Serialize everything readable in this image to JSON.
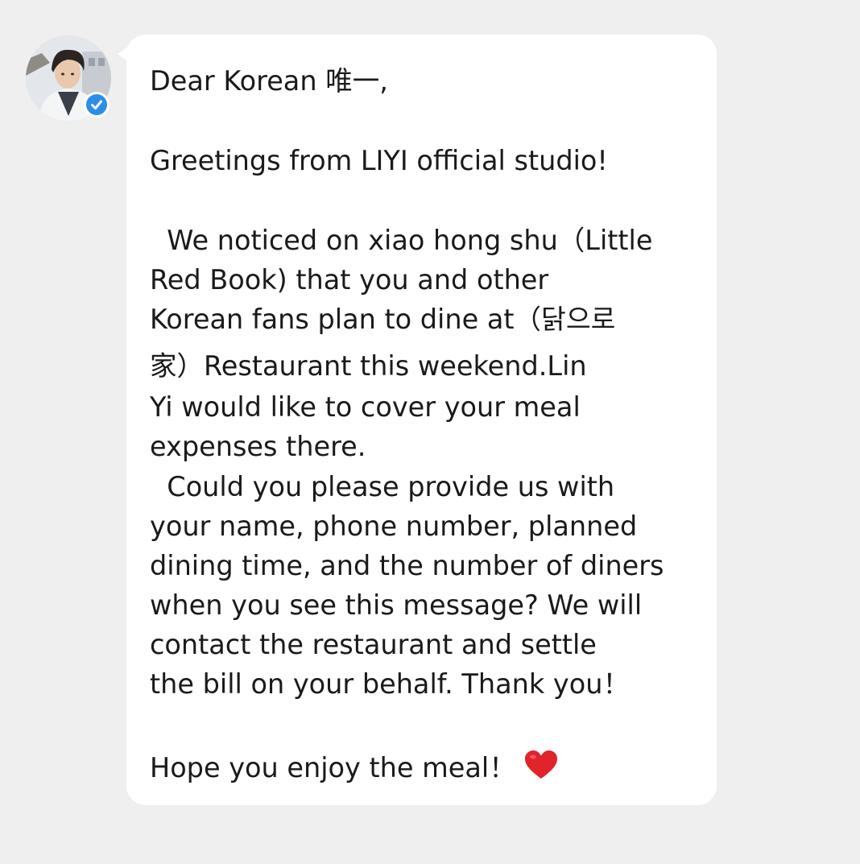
{
  "sender": {
    "avatar_icon": "profile-photo",
    "verified_icon": "verified-badge-icon",
    "verified_color": "#2b8fea"
  },
  "message": {
    "greeting": "Dear Korean 唯一,",
    "intro": "Greetings from LIYI official studio!",
    "body_lines": [
      "  We noticed on xiao hong shu（Little",
      "Red Book) that you and other",
      "Korean fans plan to dine at（닭으로",
      "家）Restaurant this weekend.Lin",
      "Yi would like to cover your meal",
      "expenses there.",
      "  Could you please provide us with",
      "your name, phone number, planned",
      "dining time, and the number of diners",
      "when you see this message? We will",
      "contact the restaurant and settle",
      "the bill on your behalf. Thank you！"
    ],
    "closing": "Hope you enjoy the meal！",
    "closing_icon": "heart-icon"
  },
  "colors": {
    "background": "#efefef",
    "bubble": "#ffffff",
    "text": "#1a1a1a",
    "heart": "#e0242a"
  }
}
